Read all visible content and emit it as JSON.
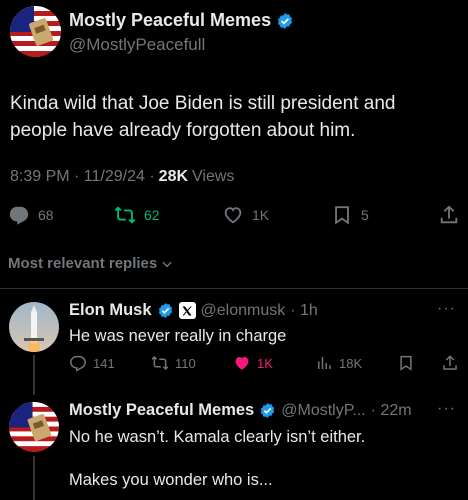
{
  "tweet": {
    "author": {
      "name": "Mostly Peaceful Memes",
      "handle": "@MostlyPeacefull"
    },
    "text": "Kinda wild that Joe Biden is still president and people have already forgotten about him.",
    "time": "8:39 PM · 11/29/24 ·",
    "views_count": "28K",
    "views_label": "Views",
    "stats": {
      "replies": "68",
      "retweets": "62",
      "likes": "1K",
      "bookmarks": "5"
    }
  },
  "sort_label": "Most relevant replies",
  "replies": [
    {
      "name": "Elon Musk",
      "handle": "@elonmusk",
      "time": "· 1h",
      "text": "He was never really in charge",
      "stats": {
        "replies": "141",
        "retweets": "110",
        "likes": "1K",
        "views": "18K"
      }
    },
    {
      "name": "Mostly Peaceful Memes",
      "handle": "@MostlyP...",
      "time": "· 22m",
      "text_line1": "No he wasn’t. Kamala clearly isn’t either.",
      "text_line2": "Makes you wonder who is..."
    }
  ],
  "more_label": "···",
  "colors": {
    "accent": "#1d9bf0",
    "retweet": "#00ba7c",
    "like": "#f91880",
    "muted": "#71767b"
  }
}
